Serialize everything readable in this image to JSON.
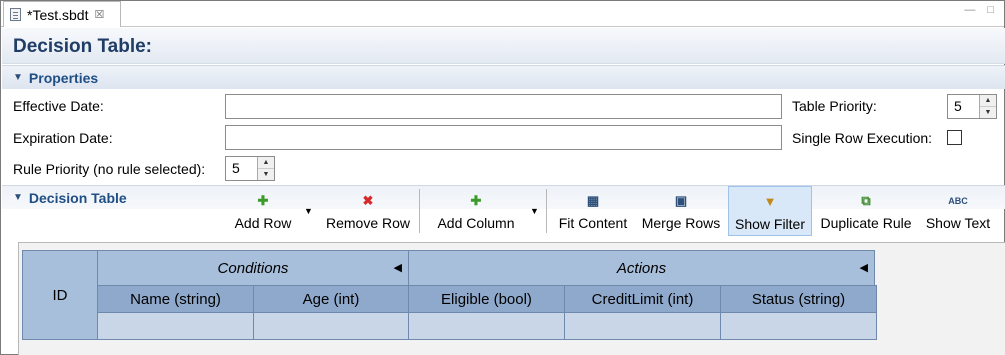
{
  "tab": {
    "title": "*Test.sbdt",
    "close": "☒"
  },
  "window_controls": {
    "minimize": "—",
    "maximize": "□"
  },
  "page_title": "Decision Table:",
  "properties": {
    "section_title": "Properties",
    "effective_date": {
      "label": "Effective Date:",
      "value": ""
    },
    "expiration_date": {
      "label": "Expiration Date:",
      "value": ""
    },
    "rule_priority": {
      "label": "Rule Priority (no rule selected):",
      "value": "5"
    },
    "table_priority": {
      "label": "Table Priority:",
      "value": "5"
    },
    "single_row_execution": {
      "label": "Single Row Execution:",
      "checked": false
    }
  },
  "decision_table": {
    "section_title": "Decision Table",
    "toolbar": {
      "add_row": "Add Row",
      "remove_row": "Remove Row",
      "add_column": "Add Column",
      "fit_content": "Fit Content",
      "merge_rows": "Merge Rows",
      "show_filter": "Show Filter",
      "duplicate_rule": "Duplicate Rule",
      "show_text": "Show Text",
      "show_text_icon": "ABC"
    },
    "grid": {
      "id_header": "ID",
      "conditions_label": "Conditions",
      "actions_label": "Actions",
      "condition_columns": [
        "Name (string)",
        "Age (int)"
      ],
      "action_columns": [
        "Eligible (bool)",
        "CreditLimit (int)",
        "Status (string)"
      ]
    }
  },
  "colors": {
    "title": "#1f3d66",
    "section_title": "#1f4f85",
    "group_header": "#a8bfdc",
    "column_header": "#8fa9cc",
    "row": "#c9d6e8",
    "active_button": "#d9e8f8"
  },
  "icons": {
    "add": "green-plus-icon",
    "remove": "red-x-icon",
    "fit_content": "fit-content-icon",
    "merge_rows": "merge-rows-icon",
    "show_filter": "filter-icon",
    "duplicate_rule": "duplicate-icon",
    "show_text": "abc-text-icon"
  }
}
